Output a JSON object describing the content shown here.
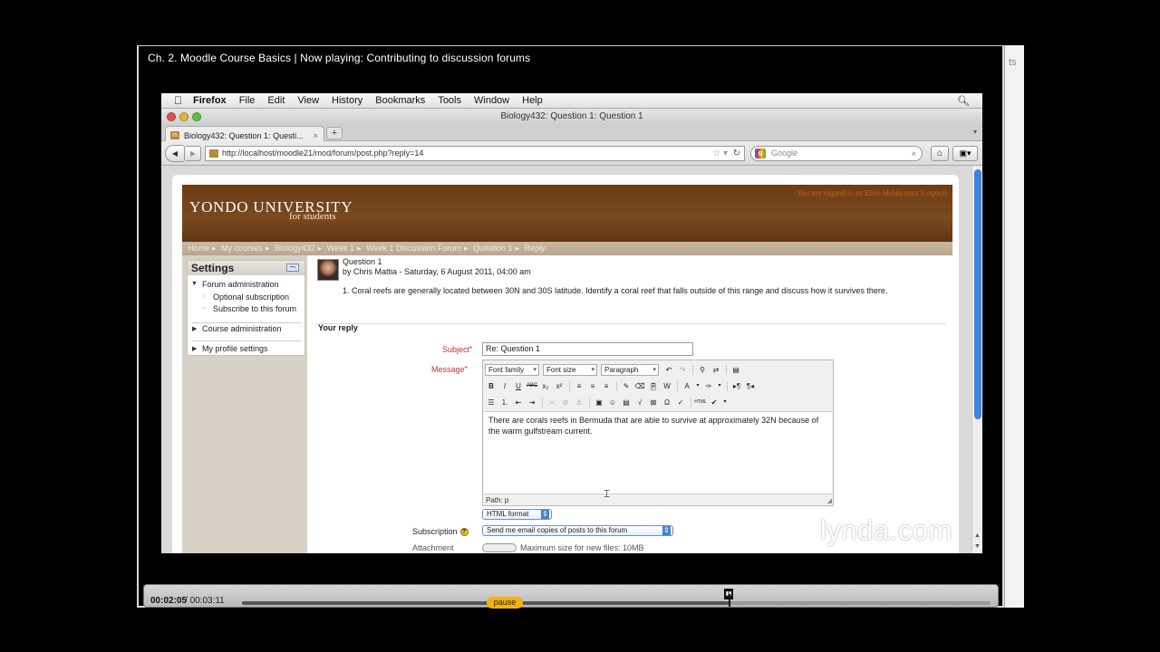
{
  "video": {
    "chapter_title": "Ch. 2. Moodle Course Basics | Now playing: Contributing to discussion forums",
    "watermark": "lynda.com",
    "time_current": "00:02:05",
    "time_separator": "/",
    "time_total": "00:03:11",
    "progress": 0.65,
    "pause_label": "pause",
    "bg_window_text": "ts"
  },
  "mac_menubar": {
    "apple": "",
    "items": [
      "Firefox",
      "File",
      "Edit",
      "View",
      "History",
      "Bookmarks",
      "Tools",
      "Window",
      "Help"
    ],
    "spotlight_icon": "search-icon"
  },
  "browser": {
    "window_title": "Biology432: Question 1: Question 1",
    "tab_label": "Biology432: Question 1: Questi...",
    "tab_close": "×",
    "new_tab": "+",
    "url": "http://localhost/moodle21/mod/forum/post.php?reply=14",
    "search_placeholder": "Google",
    "search_engine_icon": "google-icon"
  },
  "site": {
    "logo_main": "YONDO UNIVERSITY",
    "logo_sub": "for students",
    "logged_in": "You are logged in as Elvin McNamara (Logout)",
    "brand_color": "#6b3d18",
    "breadcrumbs": [
      "Home",
      "My courses",
      "Biology432",
      "Week 1",
      "Week 1 Discussion Forum",
      "Question 1",
      "Reply"
    ]
  },
  "settings": {
    "title": "Settings",
    "forum_admin": "Forum administration",
    "optional_subscription": "Optional subscription",
    "subscribe": "Subscribe to this forum",
    "course_admin": "Course administration",
    "profile_settings": "My profile settings"
  },
  "post": {
    "subject": "Question 1",
    "byline": "by Chris Mattia - Saturday, 6 August 2011, 04:00 am",
    "body": "1. Coral reefs are generally located between 30N and 30S latitude.  Identify a coral reef that falls outside of this range and discuss how it survives there."
  },
  "reply": {
    "heading": "Your reply",
    "subject_label": "Subject",
    "subject_value": "Re: Question 1",
    "message_label": "Message",
    "required_mark": "*",
    "font_family": "Font family",
    "font_size": "Font size",
    "paragraph": "Paragraph",
    "editor_text": "There are corals reefs in Bermuda that are able to survive at approximately 32N because of the warm gulfstream current.",
    "path": "Path: p",
    "format": "HTML format",
    "subscription_label": "Subscription",
    "subscription_value": "Send me email copies of posts to this forum",
    "attachment_label": "Attachment",
    "attachment_note": "Maximum size for new files: 10MB"
  }
}
